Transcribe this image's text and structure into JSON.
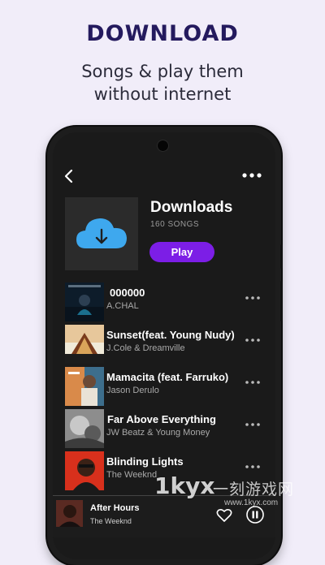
{
  "promo": {
    "title": "DOWNLOAD",
    "subtitle_line1": "Songs & play them",
    "subtitle_line2": "without internet"
  },
  "header": {
    "back_icon": "chevron-left-icon",
    "menu_icon": "more-horizontal-icon"
  },
  "playlist": {
    "title": "Downloads",
    "count": "160 SONGS",
    "play_label": "Play",
    "cover_icon": "cloud-download-icon",
    "accent_color": "#7c1ee6",
    "cloud_color": "#3ea8ee"
  },
  "songs": [
    {
      "title": "000000",
      "artist": "A.CHAL"
    },
    {
      "title": "Sunset(feat. Young Nudy)",
      "artist": "J.Cole & Dreamville"
    },
    {
      "title": "Mamacita (feat. Farruko)",
      "artist": "Jason Derulo"
    },
    {
      "title": "Far Above Everything",
      "artist": "JW Beatz & Young Money"
    },
    {
      "title": "Blinding Lights",
      "artist": "The Weeknd"
    }
  ],
  "now_playing": {
    "title": "After Hours",
    "artist": "The Weeknd",
    "favorite_icon": "heart-icon",
    "control_icon": "pause-icon"
  },
  "watermark": {
    "logo": "1kyx",
    "cn": "一刻游戏网",
    "url": "www.1kyx.com"
  }
}
